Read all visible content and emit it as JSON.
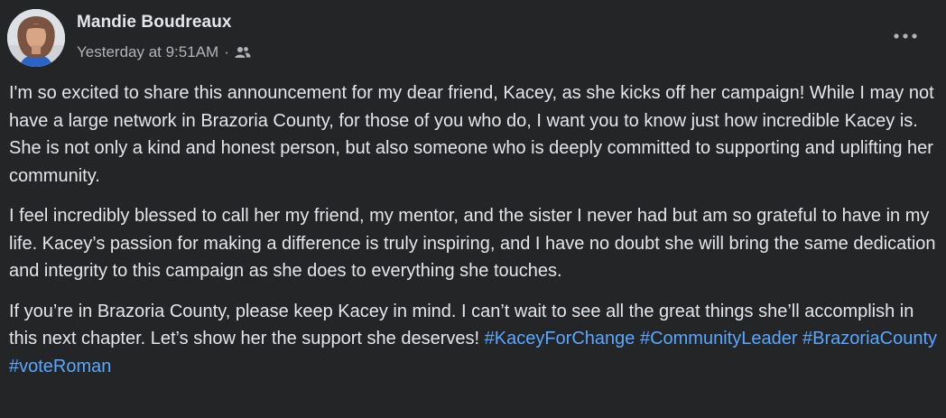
{
  "post": {
    "author": "Mandie Boudreaux",
    "timestamp": "Yesterday at 9:51AM",
    "separator": "·",
    "audience_icon": "friends-icon",
    "more_icon": "more-options-icon",
    "paragraphs": [
      "I'm so excited to share this announcement for my dear friend, Kacey, as she kicks off her campaign! While I may not have a large network in Brazoria County, for those of you who do, I want you to know just how incredible Kacey is. She is not only a kind and honest person, but also someone who is deeply committed to supporting and uplifting her community.",
      "I feel incredibly blessed to call her my friend, my mentor, and the sister I never had but am so grateful to have in my life. Kacey’s passion for making a difference is truly inspiring, and I have no doubt she will bring the same dedication and integrity to this campaign as she does to everything she touches.",
      "If you’re in Brazoria County, please keep Kacey in mind. I can’t wait to see all the great things she’ll accomplish in this next chapter. Let’s show her the support she deserves!"
    ],
    "hashtags": [
      "#KaceyForChange",
      "#CommunityLeader",
      "#BrazoriaCounty",
      "#voteRoman"
    ]
  },
  "colors": {
    "background": "#242526",
    "primary_text": "#e4e6eb",
    "secondary_text": "#b0b3b8",
    "hashtag": "#5aa7ff"
  }
}
